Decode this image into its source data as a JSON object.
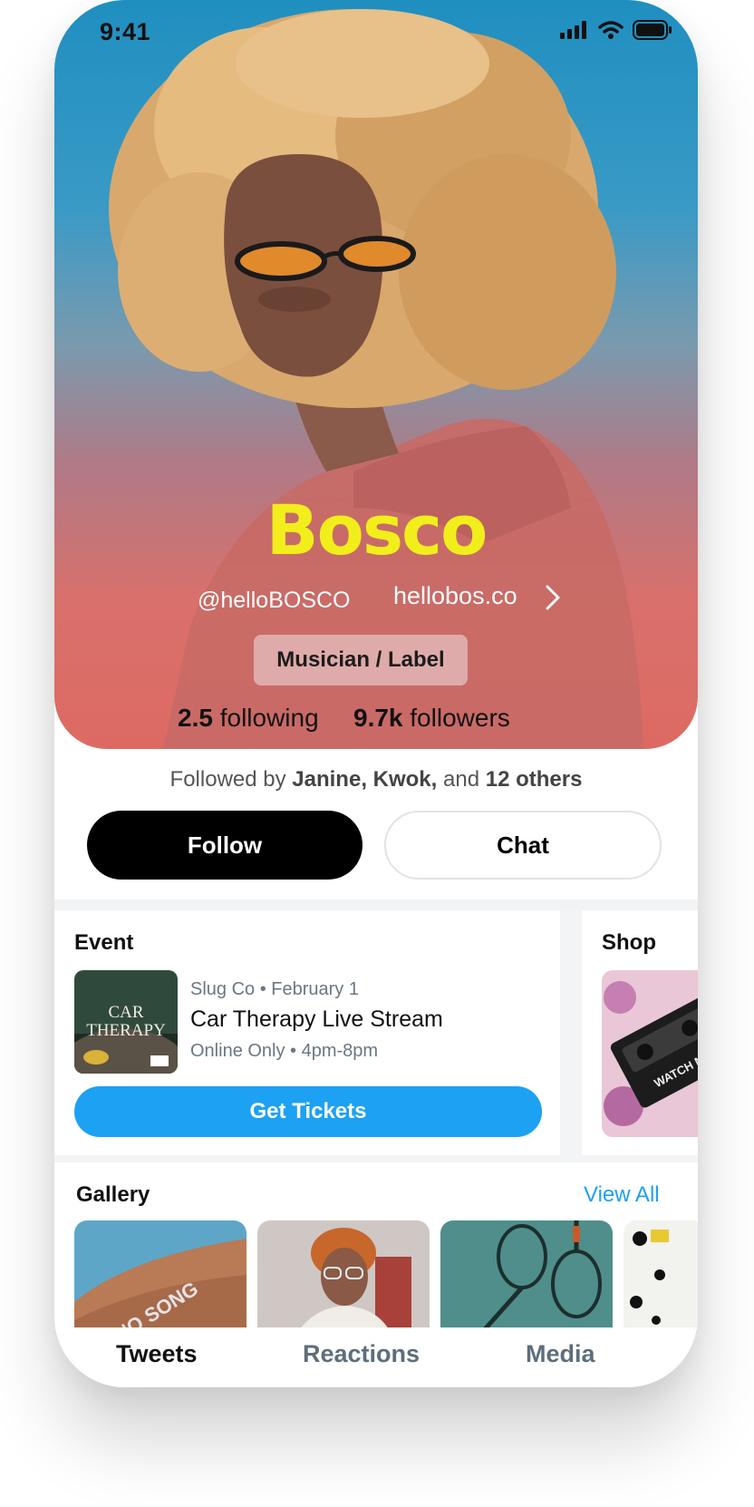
{
  "status_bar": {
    "time": "9:41"
  },
  "profile": {
    "name": "Bosco",
    "handle": "@helloBOSCO",
    "website": "hellobos.co",
    "role": "Musician / Label",
    "following_value": "2.5",
    "following_label": "following",
    "followers_value": "9.7k",
    "followers_label": "followers"
  },
  "social": {
    "followed_by_prefix": "Followed by",
    "followed_by_names": "Janine, Kwok,",
    "followed_by_and": "and",
    "followed_by_others": "12 others"
  },
  "actions": {
    "follow_label": "Follow",
    "chat_label": "Chat"
  },
  "event": {
    "section_title": "Event",
    "thumb_text_line1": "CAR",
    "thumb_text_line2": "THERAPY",
    "meta": "Slug Co • February 1",
    "title": "Car Therapy Live Stream",
    "sub": "Online Only • 4pm-8pm",
    "button_label": "Get Tickets"
  },
  "shop": {
    "section_title": "Shop",
    "thumb_text": "WATCH ME"
  },
  "gallery": {
    "title": "Gallery",
    "view_all_label": "View All",
    "tattoo_text": "NO SONG"
  },
  "tabs": [
    {
      "label": "Tweets",
      "active": true
    },
    {
      "label": "Reactions",
      "active": false
    },
    {
      "label": "Media",
      "active": false
    }
  ],
  "colors": {
    "name_yellow": "#f2ee1b",
    "accent_blue": "#1da1f2",
    "hero_top": "#1f8fc0",
    "hero_bottom": "#dd6a62"
  }
}
